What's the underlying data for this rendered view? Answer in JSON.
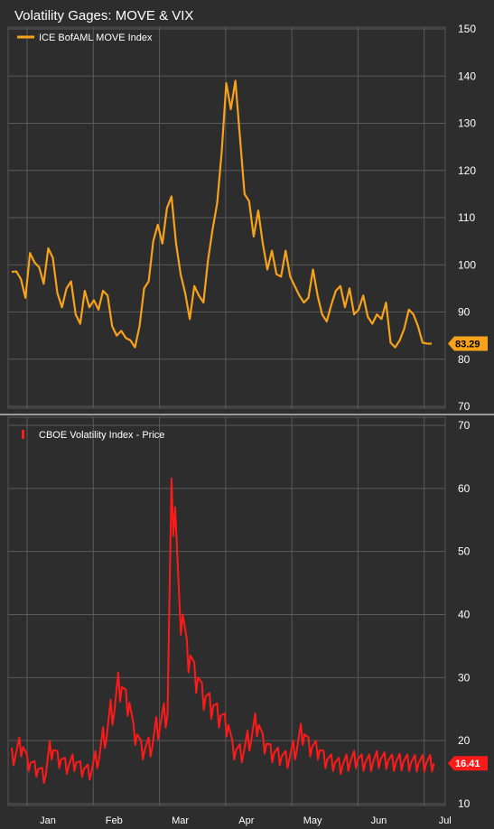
{
  "title": "Volatility Gages: MOVE & VIX",
  "colors": {
    "background": "#2d2d2d",
    "grid": "#5a5a5a",
    "text": "#ffffff",
    "move": "#f7a21b",
    "vix": "#ff1a1a"
  },
  "chart_data": [
    {
      "type": "line",
      "title": "Volatility Gages: MOVE & VIX",
      "series": [
        {
          "name": "ICE BofAML MOVE Index"
        }
      ],
      "ylim": [
        70,
        150
      ],
      "yticks": [
        "150",
        "140",
        "130",
        "120",
        "110",
        "100",
        "90",
        "80",
        "70"
      ],
      "last_value_label": "83.29",
      "x": [
        0.0,
        0.3,
        0.6,
        0.9,
        1.2,
        1.5,
        1.8,
        2.1,
        2.4,
        2.7,
        3.0,
        3.3,
        3.6,
        3.9,
        4.2,
        4.5,
        4.8,
        5.1,
        5.4,
        5.7,
        6.0,
        6.3,
        6.6,
        6.9,
        7.2,
        7.5,
        7.8,
        8.1,
        8.4,
        8.7,
        9.0,
        9.3,
        9.6,
        9.9,
        10.2,
        10.5,
        10.8,
        11.1,
        11.4,
        11.7,
        12.0,
        12.3,
        12.6,
        12.9,
        13.2,
        13.5,
        13.8,
        14.1,
        14.4,
        14.7,
        15.0,
        15.3,
        15.6,
        15.9,
        16.2,
        16.5,
        16.8,
        17.1,
        17.4,
        17.7,
        18.0,
        18.3,
        18.6,
        18.9,
        19.2,
        19.5,
        19.8,
        20.1,
        20.4,
        20.7,
        21.0,
        21.3,
        21.6,
        21.9,
        22.2,
        22.5,
        22.8,
        23.1,
        23.4,
        23.7,
        24.0,
        24.3,
        24.6,
        24.9,
        25.2,
        25.5,
        25.8,
        26.1,
        26.4,
        26.7,
        27.0,
        27.3,
        27.6
      ],
      "values": [
        98.5,
        98.6,
        97.0,
        93.0,
        102.5,
        100.5,
        99.5,
        96.0,
        103.5,
        101.5,
        94.0,
        91.0,
        95.0,
        96.5,
        89.5,
        87.5,
        94.5,
        91.0,
        92.5,
        90.5,
        94.5,
        93.5,
        87.0,
        85.0,
        86.0,
        84.5,
        84.0,
        82.5,
        87.0,
        95.0,
        96.5,
        105.0,
        108.5,
        104.5,
        112.0,
        114.5,
        104.5,
        98.0,
        94.0,
        88.5,
        95.5,
        93.5,
        92.0,
        101.0,
        107.5,
        113.0,
        124.0,
        138.5,
        133.0,
        139.0,
        127.0,
        115.0,
        113.5,
        106.0,
        111.5,
        104.5,
        99.0,
        103.0,
        98.0,
        97.5,
        103.0,
        97.5,
        95.5,
        93.5,
        92.0,
        93.0,
        99.0,
        93.5,
        89.5,
        88.0,
        91.5,
        94.5,
        95.5,
        91.0,
        95.0,
        89.5,
        90.5,
        93.5,
        89.0,
        87.5,
        89.5,
        88.5,
        92.0,
        83.5,
        82.5,
        84.0,
        86.5,
        90.5,
        89.5,
        87.0,
        83.5,
        83.3,
        83.29
      ],
      "xticks": [
        "Jan",
        "Feb",
        "Mar",
        "Apr",
        "May",
        "Jun",
        "Jul"
      ],
      "grid": true,
      "legend": "top-left"
    },
    {
      "type": "line",
      "series": [
        {
          "name": "CBOE Volatility Index - Price"
        }
      ],
      "ylim": [
        10,
        70
      ],
      "yticks": [
        "70",
        "60",
        "50",
        "40",
        "30",
        "20",
        "10"
      ],
      "last_value_label": "16.41",
      "x": [
        0.0,
        0.5,
        1.0,
        1.5,
        2.0,
        2.5,
        3.0,
        3.5,
        4.0,
        4.5,
        5.0,
        5.5,
        6.0,
        6.5,
        7.0,
        7.5,
        8.0,
        8.5,
        9.0,
        9.5,
        10.0,
        10.5,
        11.0,
        11.5,
        12.0,
        12.5,
        13.0,
        13.5,
        14.0,
        14.5,
        15.0,
        15.5,
        16.0,
        16.5,
        17.0,
        17.5,
        18.0,
        18.5,
        19.0,
        19.5,
        20.0,
        20.5,
        21.0,
        21.5,
        22.0,
        22.5,
        23.0,
        23.5,
        24.0,
        24.5,
        25.0,
        25.5,
        26.0,
        26.5,
        27.0,
        27.5
      ],
      "values": [
        17.5,
        19.0,
        16.5,
        15.5,
        14.5,
        18.5,
        17.0,
        16.0,
        16.5,
        15.5,
        15.0,
        17.0,
        20.5,
        24.5,
        28.5,
        26.0,
        21.0,
        18.5,
        19.0,
        22.0,
        24.0,
        57.0,
        40.0,
        33.5,
        30.0,
        27.0,
        25.5,
        24.0,
        22.5,
        18.5,
        18.0,
        20.0,
        22.5,
        19.5,
        18.0,
        17.5,
        17.0,
        18.5,
        21.0,
        19.0,
        18.5,
        17.0,
        16.5,
        16.0,
        16.5,
        17.0,
        16.5,
        16.5,
        17.0,
        16.8,
        16.5,
        16.6,
        16.5,
        16.4,
        16.4,
        16.41
      ],
      "xticks": [
        "Jan",
        "Feb",
        "Mar",
        "Apr",
        "May",
        "Jun",
        "Jul"
      ],
      "grid": true,
      "legend": "top-left"
    }
  ]
}
